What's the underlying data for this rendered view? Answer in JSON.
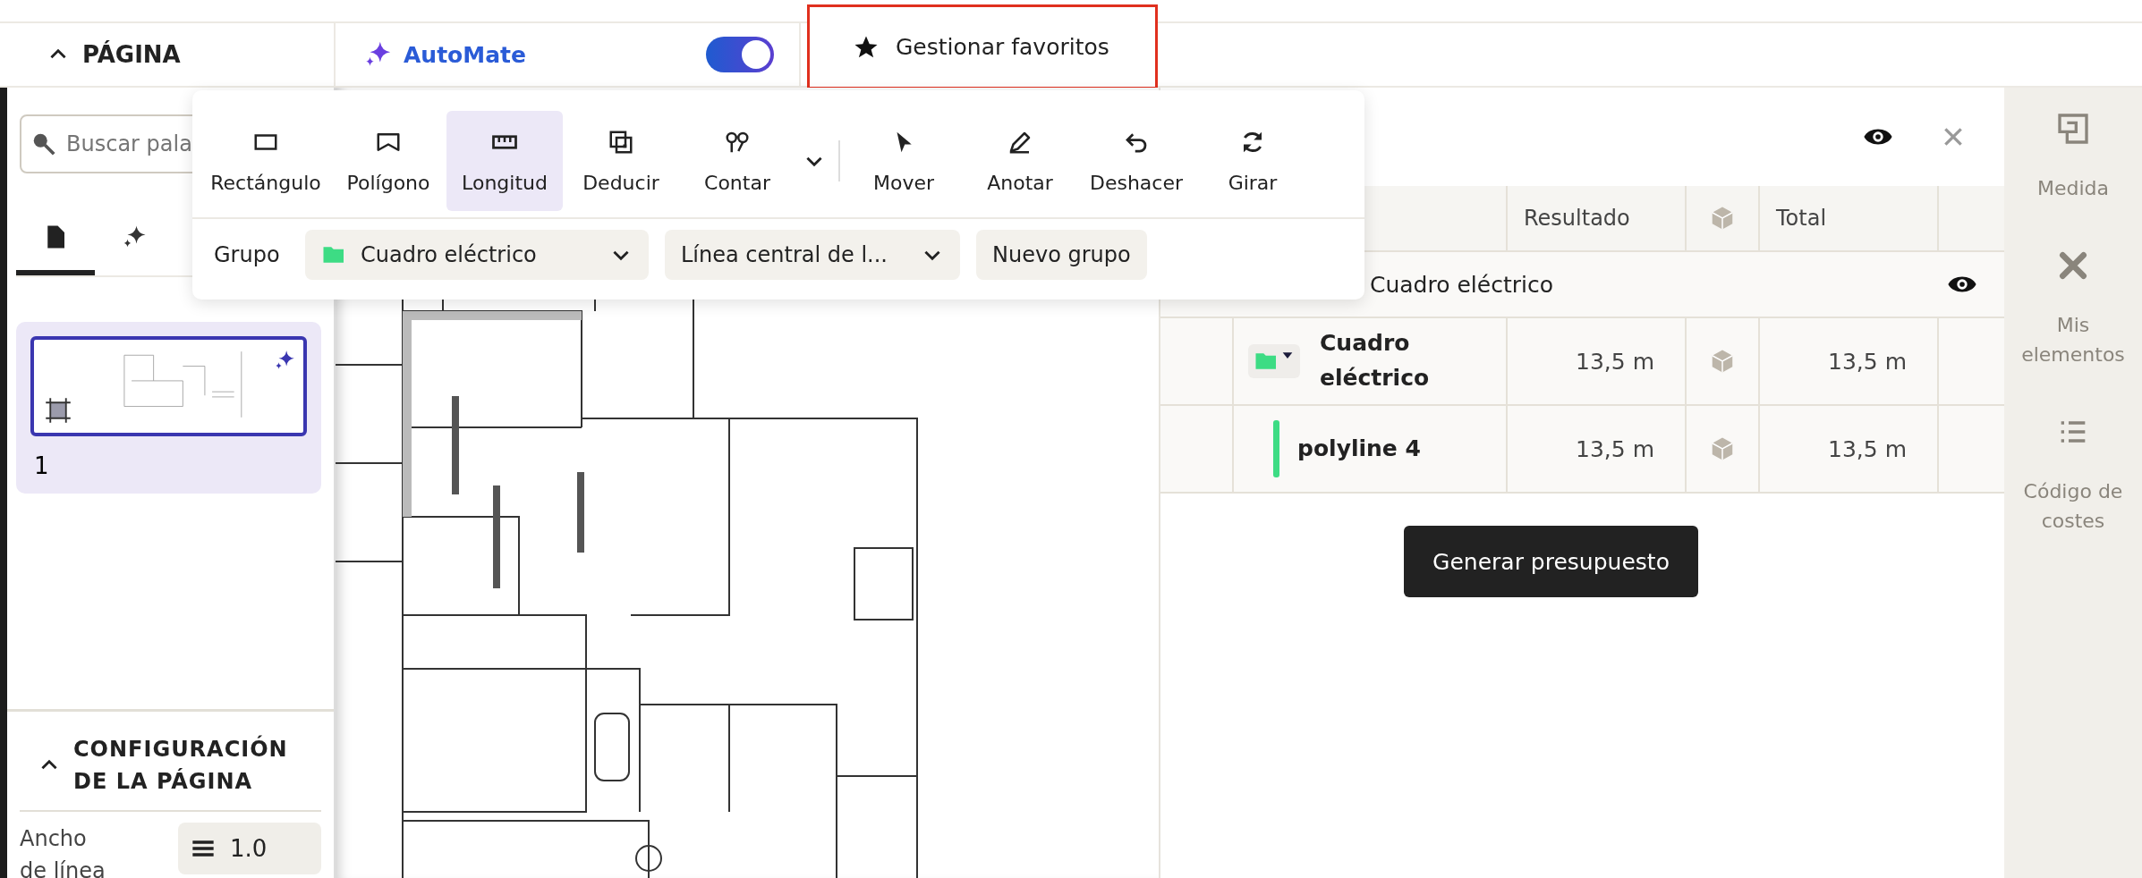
{
  "page_panel": {
    "title": "PÁGINA",
    "expanded": true
  },
  "automate": {
    "label": "AutoMate",
    "on": true
  },
  "favorites_button": {
    "label": "Gestionar favoritos",
    "highlighted": true
  },
  "search": {
    "placeholder": "Buscar pala"
  },
  "sidebar_tabs": [
    {
      "kind": "page",
      "selected": true
    },
    {
      "kind": "ai",
      "selected": false
    }
  ],
  "pages": [
    {
      "label": "1",
      "selected": true
    }
  ],
  "page_settings": {
    "title": "CONFIGURACIÓN DE LA PÁGINA",
    "expanded": true,
    "line_width_label": "Ancho de línea",
    "line_width_value": "1.0"
  },
  "toolbar": {
    "tools": [
      {
        "kind": "rectangle",
        "label": "Rectángulo",
        "selected": false,
        "has_menu": false
      },
      {
        "kind": "polygon",
        "label": "Polígono",
        "selected": false,
        "has_menu": false
      },
      {
        "kind": "length",
        "label": "Longitud",
        "selected": true,
        "has_menu": false
      },
      {
        "kind": "deduct",
        "label": "Deducir",
        "selected": false,
        "has_menu": false
      },
      {
        "kind": "count",
        "label": "Contar",
        "selected": false,
        "has_menu": true
      },
      {
        "kind": "move",
        "label": "Mover",
        "selected": false,
        "has_menu": false
      },
      {
        "kind": "annotate",
        "label": "Anotar",
        "selected": false,
        "has_menu": false
      },
      {
        "kind": "undo",
        "label": "Deshacer",
        "selected": false,
        "has_menu": false
      },
      {
        "kind": "rotate",
        "label": "Girar",
        "selected": false,
        "has_menu": false
      }
    ],
    "group_label": "Grupo",
    "group": "Cuadro eléctrico",
    "mode": "Línea central de l...",
    "new_group": "Nuevo grupo"
  },
  "table": {
    "columns": [
      "Resultado",
      "Total"
    ],
    "group_row": {
      "name": "Cuadro eléctrico"
    },
    "rows": [
      {
        "kind": "folder",
        "name": "Cuadro eléctrico",
        "result": "13,5 m",
        "total": "13,5 m"
      },
      {
        "kind": "line",
        "name": "polyline 4",
        "color": "#3ddc84",
        "result": "13,5 m",
        "total": "13,5 m"
      }
    ]
  },
  "budget_button": "Generar presupuesto",
  "right_rail": [
    {
      "kind": "measure",
      "label": "Medida"
    },
    {
      "kind": "elements",
      "label": "Mis elementos"
    },
    {
      "kind": "costs",
      "label": "Código de costes"
    }
  ]
}
